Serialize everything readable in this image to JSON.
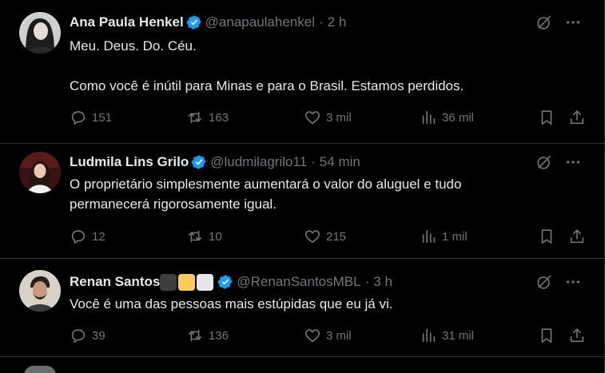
{
  "tweets": [
    {
      "name": "Ana Paula Henkel",
      "handle": "@anapaulahenkel",
      "time": "2 h",
      "text": "Meu. Deus. Do. Céu.\n\nComo você é inútil para Minas e para o Brasil. Estamos perdidos.",
      "replies": "151",
      "reposts": "163",
      "likes": "3 mil",
      "views": "36 mil"
    },
    {
      "name": "Ludmila Lins Grilo",
      "handle": "@ludmilagrilo11",
      "time": "54 min",
      "text": "O proprietário simplesmente aumentará o valor do aluguel e tudo\npermanecerá rigorosamente igual.",
      "replies": "12",
      "reposts": "10",
      "likes": "215",
      "views": "1 mil"
    },
    {
      "name": "Renan Santos",
      "handle": "@RenanSantosMBL",
      "time": "3 h",
      "text": "Você é uma das pessoas mais estúpidas que eu já vi.",
      "replies": "39",
      "reposts": "136",
      "likes": "3 mil",
      "views": "31 mil"
    }
  ],
  "icons": {
    "verified": "verified-badge-icon",
    "grok": "grok-icon",
    "more": "more-icon",
    "reply": "reply-icon",
    "repost": "repost-icon",
    "like": "heart-icon",
    "views": "views-icon",
    "bookmark": "bookmark-icon",
    "share": "share-icon"
  },
  "colors": {
    "background": "#000000",
    "text": "#e7e9ea",
    "muted": "#71767b",
    "verified": "#1d9bf0",
    "divider": "#2f3336"
  }
}
